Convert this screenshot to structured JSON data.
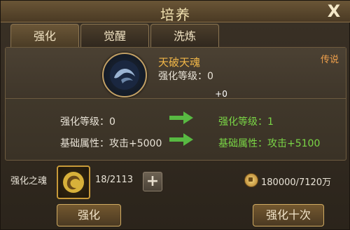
{
  "window": {
    "title": "培养",
    "close_label": "X"
  },
  "tabs": [
    {
      "label": "强化",
      "active": true
    },
    {
      "label": "觉醒",
      "active": false
    },
    {
      "label": "洗炼",
      "active": false
    }
  ],
  "item": {
    "rarity": "传说",
    "name": "天破天魂",
    "level_badge": "+0",
    "level_text": "强化等级：0",
    "icon": "dark-soul-icon"
  },
  "upgrade": {
    "current_level": "强化等级：0",
    "current_attr": "基础属性：攻击+5000",
    "next_level": "强化等级：1",
    "next_attr": "基础属性：攻击+5100"
  },
  "materials": {
    "label": "强化之魂",
    "count": "18/2113",
    "add_label": "+",
    "currency": "180000/7120万",
    "currency_icon": "coin-icon"
  },
  "buttons": {
    "enhance": "强化",
    "enhance_ten": "强化十次"
  },
  "colors": {
    "legend": "#f2a24c",
    "item_name": "#f0b648",
    "next_value": "#7ad646"
  }
}
